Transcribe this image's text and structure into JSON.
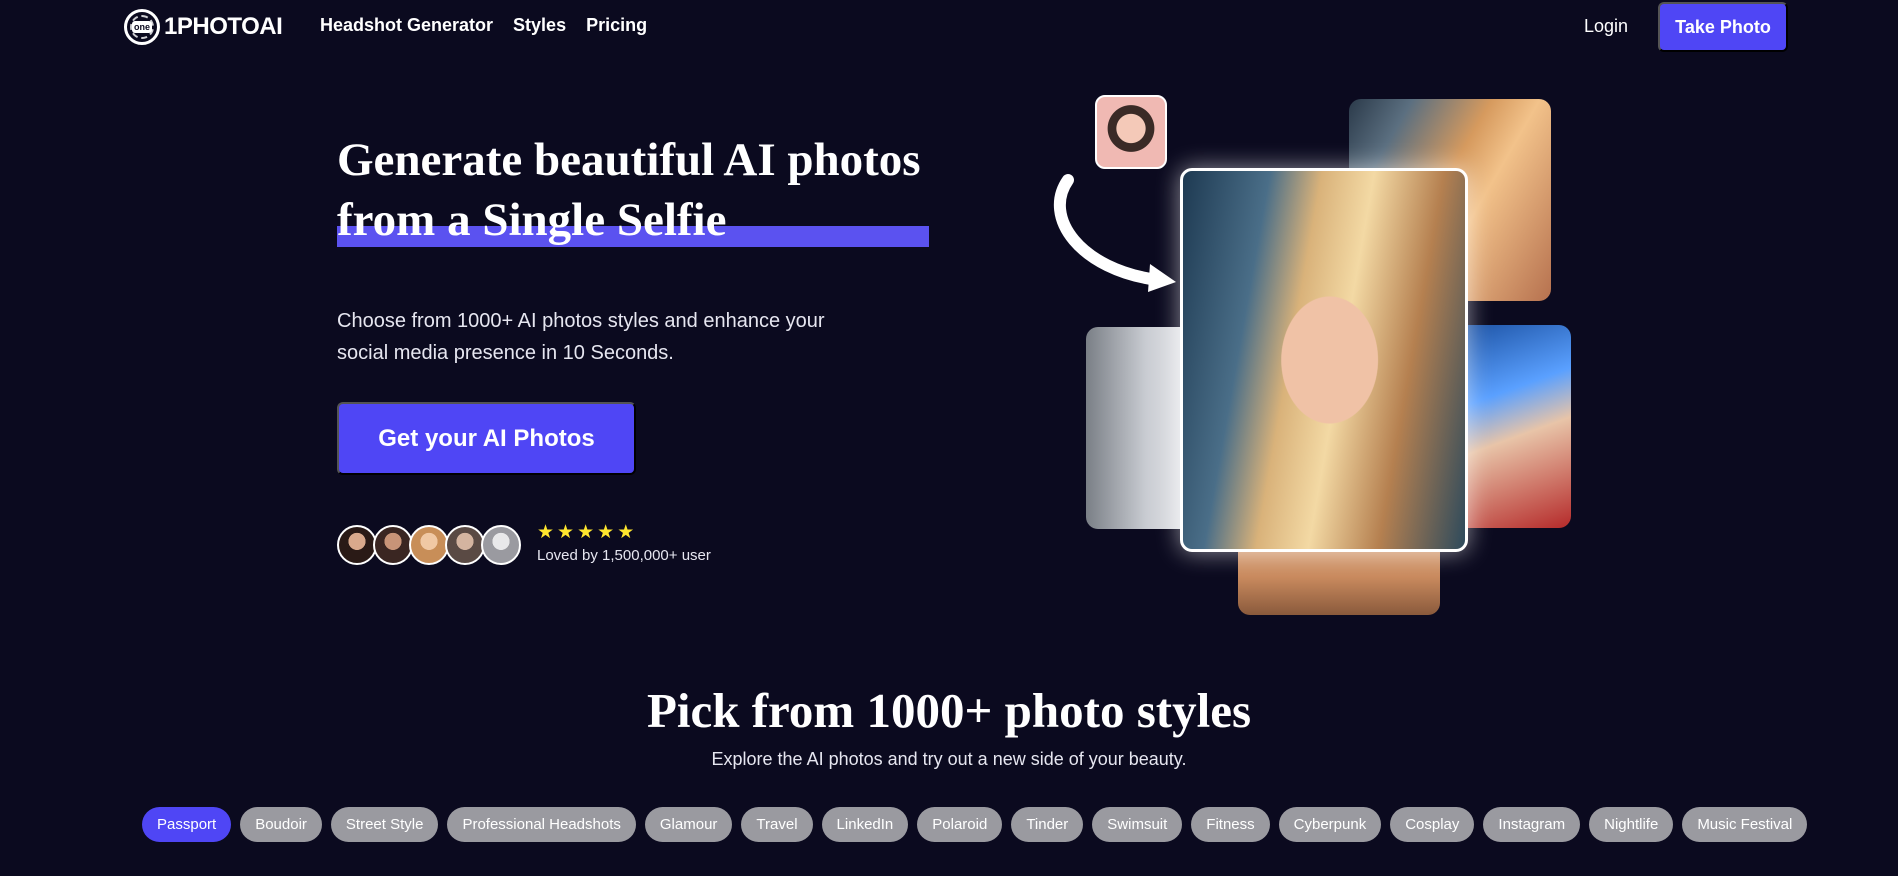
{
  "nav": {
    "logo_badge": "one",
    "logo_text": "1PHOTOAI",
    "links": [
      "Headshot Generator",
      "Styles",
      "Pricing"
    ],
    "login": "Login",
    "cta": "Take Photo"
  },
  "hero": {
    "title_line1": "Generate beautiful AI photos",
    "title_line2": "from a Single Selfie",
    "subtitle": "Choose from 1000+ AI photos styles and enhance your social media presence in 10 Seconds.",
    "cta": "Get your AI Photos",
    "rating_stars": 5,
    "loved_text": "Loved by 1,500,000+ user"
  },
  "styles_section": {
    "title": "Pick from 1000+ photo styles",
    "subtitle": "Explore the AI photos and try out a new side of your beauty.",
    "active": "Passport",
    "chips": [
      "Passport",
      "Boudoir",
      "Street Style",
      "Professional Headshots",
      "Glamour",
      "Travel",
      "LinkedIn",
      "Polaroid",
      "Tinder",
      "Swimsuit",
      "Fitness",
      "Cyberpunk",
      "Cosplay",
      "Instagram",
      "Nightlife",
      "Music Festival"
    ]
  },
  "colors": {
    "background": "#0b0a1f",
    "accent": "#4f46f5",
    "chip_inactive": "#9a9aa0",
    "star": "#ffe62e"
  }
}
